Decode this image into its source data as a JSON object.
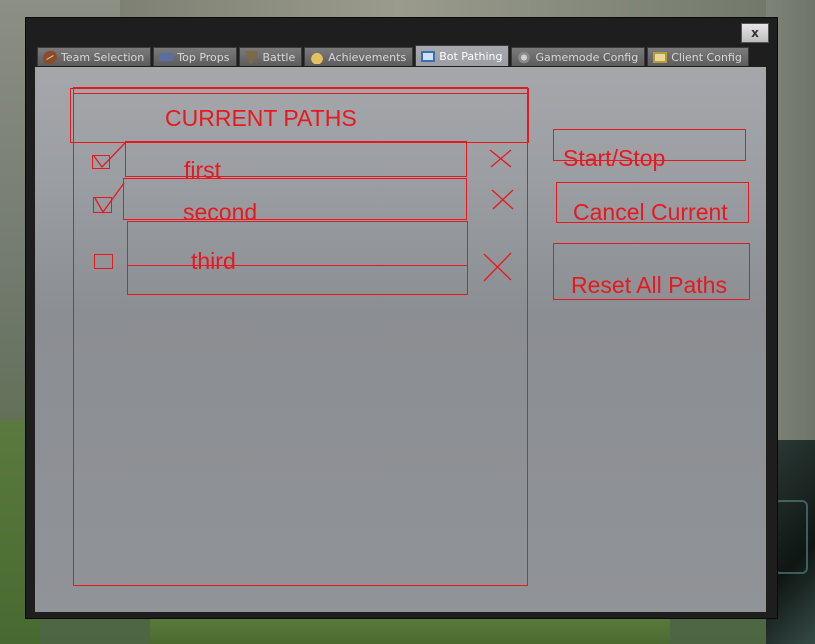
{
  "window": {
    "close_label": "x"
  },
  "tabs": [
    {
      "label": "Team Selection",
      "icon": "football-icon",
      "active": false
    },
    {
      "label": "Top Props",
      "icon": "van-icon",
      "active": false
    },
    {
      "label": "Battle",
      "icon": "sword-icon",
      "active": false
    },
    {
      "label": "Achievements",
      "icon": "medal-icon",
      "active": false
    },
    {
      "label": "Bot Pathing",
      "icon": "monitor-icon",
      "active": true
    },
    {
      "label": "Gamemode Config",
      "icon": "gear-icon",
      "active": false
    },
    {
      "label": "Client Config",
      "icon": "client-icon",
      "active": false
    }
  ],
  "paths_panel": {
    "header": "CURRENT PATHS",
    "paths": [
      {
        "name": "first",
        "checked": true
      },
      {
        "name": "second",
        "checked": true
      },
      {
        "name": "third",
        "checked": false
      }
    ]
  },
  "actions": {
    "start_stop": "Start/Stop",
    "cancel_current": "Cancel Current",
    "reset_all": "Reset All Paths"
  },
  "colors": {
    "sketch_red": "#e8181e",
    "panel_gray": "#9b9ea2",
    "frame_dark": "#1e1e1e"
  }
}
